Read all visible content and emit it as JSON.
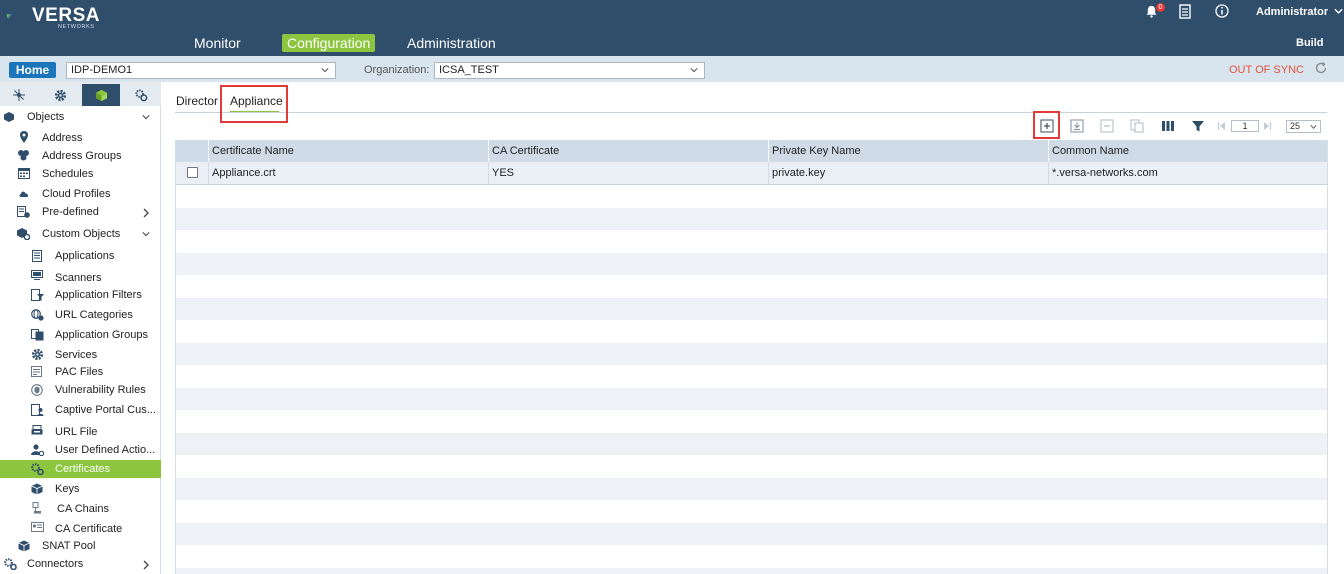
{
  "brand": {
    "name": "VERSA",
    "sub": "NETWORKS"
  },
  "nav": {
    "monitor": "Monitor",
    "configuration": "Configuration",
    "administration": "Administration"
  },
  "topright": {
    "bell_badge": "0",
    "user": "Administrator",
    "build": "Build"
  },
  "context": {
    "home": "Home",
    "appliance_value": "IDP-DEMO1",
    "org_label": "Organization:",
    "org_value": "ICSA_TEST",
    "sync_status": "OUT OF SYNC"
  },
  "sidebar": {
    "objects": "Objects",
    "address": "Address",
    "address_groups": "Address Groups",
    "schedules": "Schedules",
    "cloud_profiles": "Cloud Profiles",
    "pre_defined": "Pre-defined",
    "custom_objects": "Custom Objects",
    "applications": "Applications",
    "scanners": "Scanners",
    "application_filters": "Application Filters",
    "url_categories": "URL Categories",
    "application_groups": "Application Groups",
    "services": "Services",
    "pac_files": "PAC Files",
    "vulnerability_rules": "Vulnerability Rules",
    "captive_portal": "Captive Portal Cus...",
    "url_file": "URL File",
    "user_defined_actions": "User Defined Actio...",
    "certificates": "Certificates",
    "keys": "Keys",
    "ca_chains": "CA Chains",
    "ca_certificate": "CA Certificate",
    "snat_pool": "SNAT Pool",
    "connectors": "Connectors"
  },
  "subtabs": {
    "director": "Director",
    "appliance": "Appliance"
  },
  "pager": {
    "page": "1",
    "page_size": "25"
  },
  "table": {
    "columns": [
      "Certificate Name",
      "CA Certificate",
      "Private Key Name",
      "Common Name"
    ],
    "rows": [
      [
        "Appliance.crt",
        "YES",
        "private.key",
        "*.versa-networks.com"
      ]
    ]
  },
  "colors": {
    "header": "#2f4e6b",
    "accent": "#8cc63f",
    "highlight": "#e03a3a",
    "sync_warning": "#e5533b"
  }
}
